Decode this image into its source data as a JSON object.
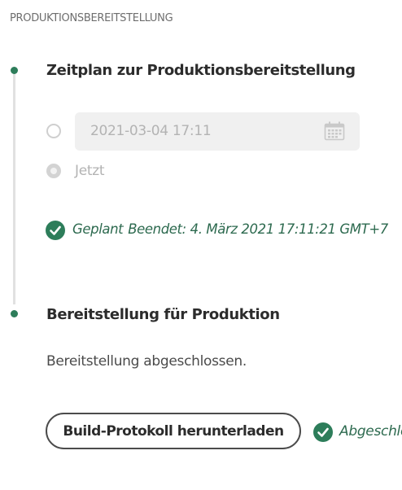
{
  "section": {
    "title": "PRODUKTIONSBEREITSTELLUNG"
  },
  "schedule_step": {
    "title": "Zeitplan zur Produktionsbereitstellung",
    "date_value": "2021-03-04 17:11",
    "date_icon": "calendar-icon",
    "now_option_label": "Jetzt",
    "status_icon": "check-circle-icon",
    "status_label": "Geplant",
    "status_detail": "Beendet: 4. März 2021 17:11:21 GMT+7"
  },
  "deploy_step": {
    "title": "Bereitstellung für Produktion",
    "description": "Bereitstellung abgeschlossen.",
    "download_button": "Build-Protokoll herunterladen",
    "done_icon": "check-circle-icon",
    "done_label": "Abgeschlossen"
  },
  "colors": {
    "accent_green": "#2d7d5a",
    "status_green_text": "#2d6a4f",
    "disabled_text": "#b3b3b3"
  }
}
